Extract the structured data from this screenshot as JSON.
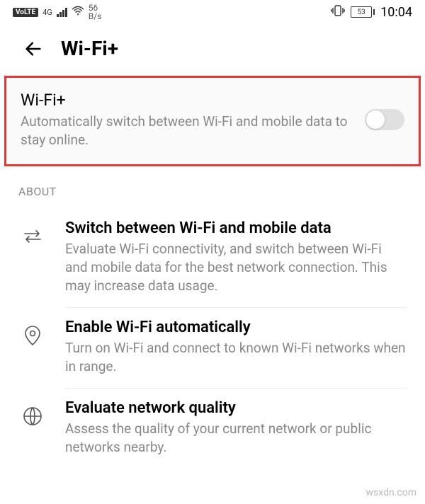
{
  "statusBar": {
    "volte": "VoLTE",
    "networkType": "4G",
    "speedValue": "56",
    "speedUnit": "B/s",
    "batteryPercent": "53",
    "time": "10:04"
  },
  "header": {
    "title": "Wi-Fi+"
  },
  "wifiPlusCard": {
    "title": "Wi-Fi+",
    "description": "Automatically switch between Wi-Fi and mobile data to stay online.",
    "toggleOn": false
  },
  "aboutSection": {
    "label": "ABOUT",
    "items": [
      {
        "icon": "swap-icon",
        "title": "Switch between Wi-Fi and mobile data",
        "description": "Evaluate Wi-Fi connectivity, and switch between Wi-Fi and mobile data for the best network connection. This may increase data usage."
      },
      {
        "icon": "location-icon",
        "title": "Enable Wi-Fi automatically",
        "description": "Turn on Wi-Fi and connect to known Wi-Fi networks when in range."
      },
      {
        "icon": "globe-icon",
        "title": "Evaluate network quality",
        "description": "Assess the quality of your current network or public networks nearby."
      }
    ]
  },
  "watermark": "wsxdn.com"
}
